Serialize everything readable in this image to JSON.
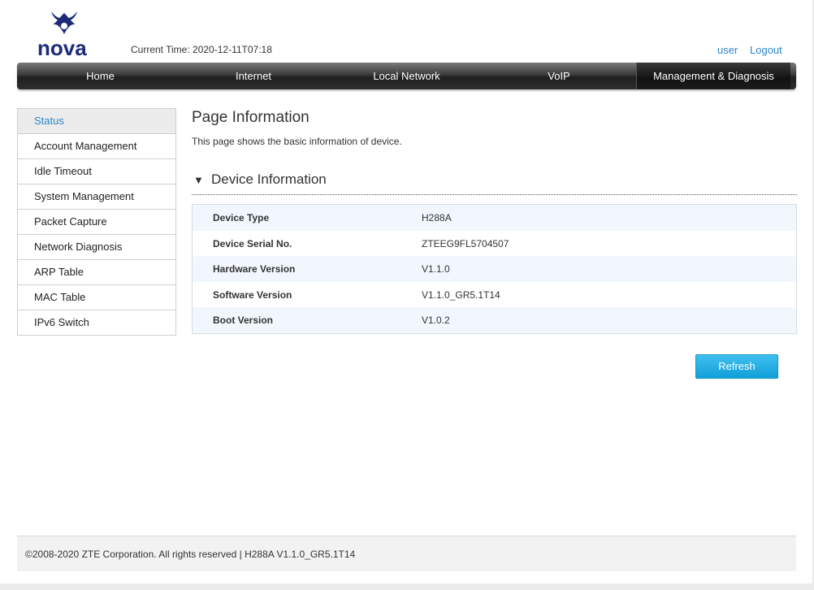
{
  "brand": {
    "logo_text": "nova"
  },
  "header": {
    "current_time_label": "Current Time:",
    "current_time_value": "2020-12-11T07:18",
    "user_link": "user",
    "logout_link": "Logout"
  },
  "nav": {
    "items": [
      {
        "label": "Home"
      },
      {
        "label": "Internet"
      },
      {
        "label": "Local Network"
      },
      {
        "label": "VoIP"
      },
      {
        "label": "Management & Diagnosis"
      }
    ],
    "active": "Management & Diagnosis"
  },
  "sidebar": {
    "items": [
      {
        "label": "Status"
      },
      {
        "label": "Account Management"
      },
      {
        "label": "Idle Timeout"
      },
      {
        "label": "System Management"
      },
      {
        "label": "Packet Capture"
      },
      {
        "label": "Network Diagnosis"
      },
      {
        "label": "ARP Table"
      },
      {
        "label": "MAC Table"
      },
      {
        "label": "IPv6 Switch"
      }
    ],
    "active": "Status"
  },
  "main": {
    "title": "Page Information",
    "description": "This page shows the basic information of device.",
    "section_title": "Device Information",
    "section_arrow": "▼",
    "rows": [
      {
        "label": "Device Type",
        "value": "H288A"
      },
      {
        "label": "Device Serial No.",
        "value": "ZTEEG9FL5704507"
      },
      {
        "label": "Hardware Version",
        "value": "V1.1.0"
      },
      {
        "label": "Software Version",
        "value": "V1.1.0_GR5.1T14"
      },
      {
        "label": "Boot Version",
        "value": "V1.0.2"
      }
    ],
    "refresh_label": "Refresh"
  },
  "footer": {
    "text": "©2008-2020 ZTE Corporation. All rights reserved  |   H288A V1.1.0_GR5.1T14"
  },
  "colors": {
    "accent": "#2b86c9",
    "button": "#1aa8e0",
    "logo": "#1b2b7a"
  }
}
